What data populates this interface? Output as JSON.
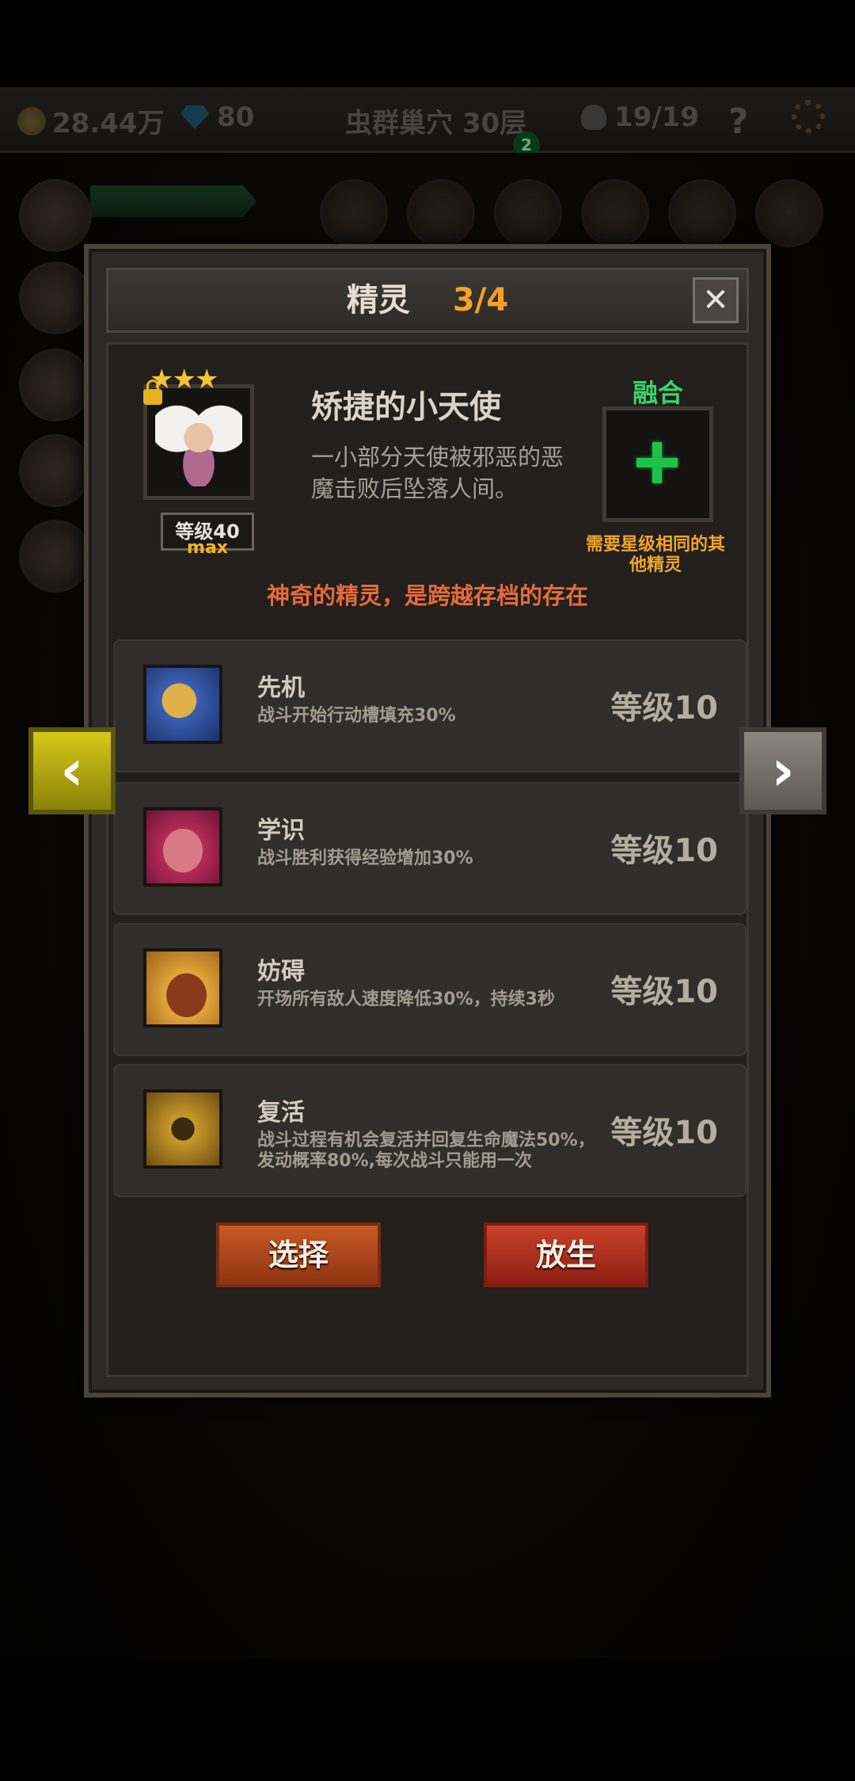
{
  "hud": {
    "gold": "28.44万",
    "gems": "80",
    "location": "虫群巢穴 30层",
    "kills": "19/19",
    "help": "?",
    "notification_badge": "2"
  },
  "dialog": {
    "title": "精灵",
    "count": "3/4",
    "close": "✕"
  },
  "spirit": {
    "stars": "★★★",
    "name": "矫捷的小天使",
    "description": "一小部分天使被邪恶的恶魔击败后坠落人间。",
    "level": "等级40",
    "max": "max",
    "fuse_label": "融合",
    "fuse_note": "需要星级相同的其他精灵",
    "slogan": "神奇的精灵，是跨越存档的存在"
  },
  "skills": [
    {
      "name": "先机",
      "desc": "战斗开始行动槽填充30%",
      "level": "等级10",
      "icon": "leopard-icon"
    },
    {
      "name": "学识",
      "desc": "战斗胜利获得经验增加30%",
      "level": "等级10",
      "icon": "wisdom-face-icon"
    },
    {
      "name": "妨碍",
      "desc": "开场所有敌人速度降低30%，持续3秒",
      "level": "等级10",
      "icon": "chained-boot-icon"
    },
    {
      "name": "复活",
      "desc": "战斗过程有机会复活并回复生命魔法50%，发动概率80%,每次战斗只能用一次",
      "level": "等级10",
      "icon": "revive-figure-icon"
    }
  ],
  "buttons": {
    "select": "选择",
    "release": "放生"
  },
  "nav": {
    "prev": "‹",
    "next": "›"
  }
}
